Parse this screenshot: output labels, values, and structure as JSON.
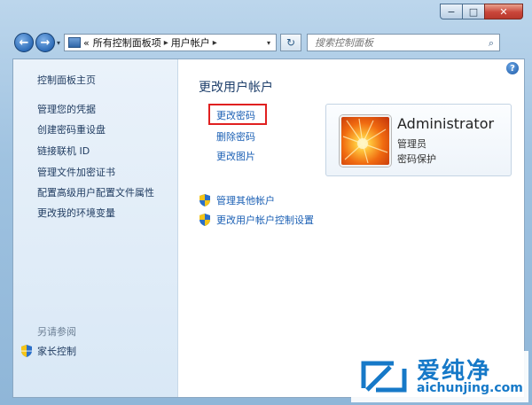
{
  "window": {
    "minimize_label": "−",
    "maximize_label": "□",
    "close_label": "✕"
  },
  "nav": {
    "back_arrow": "←",
    "forward_arrow": "→",
    "history_dropdown": "▾",
    "breadcrumb": {
      "overflow": "«",
      "items": [
        "所有控制面板项",
        "用户帐户"
      ],
      "separator": "▸",
      "dropdown": "▾"
    },
    "refresh": "↻",
    "search": {
      "placeholder": "搜索控制面板",
      "icon": "⌕"
    }
  },
  "help": "?",
  "sidebar": {
    "home": "控制面板主页",
    "links": [
      "管理您的凭据",
      "创建密码重设盘",
      "链接联机 ID",
      "管理文件加密证书",
      "配置高级用户配置文件属性",
      "更改我的环境变量"
    ],
    "see_also_heading": "另请参阅",
    "see_also_links": [
      "家长控制"
    ]
  },
  "main": {
    "title": "更改用户帐户",
    "tasks": [
      "更改密码",
      "删除密码",
      "更改图片"
    ],
    "shield_links": [
      "管理其他帐户",
      "更改用户帐户控制设置"
    ],
    "user": {
      "name": "Administrator",
      "role": "管理员",
      "status": "密码保护"
    }
  },
  "watermark": {
    "brand": "爱纯净",
    "url": "aichunjing.com"
  },
  "colors": {
    "link": "#1a5fb4",
    "highlight": "#e02020",
    "watermark": "#1679c8"
  }
}
